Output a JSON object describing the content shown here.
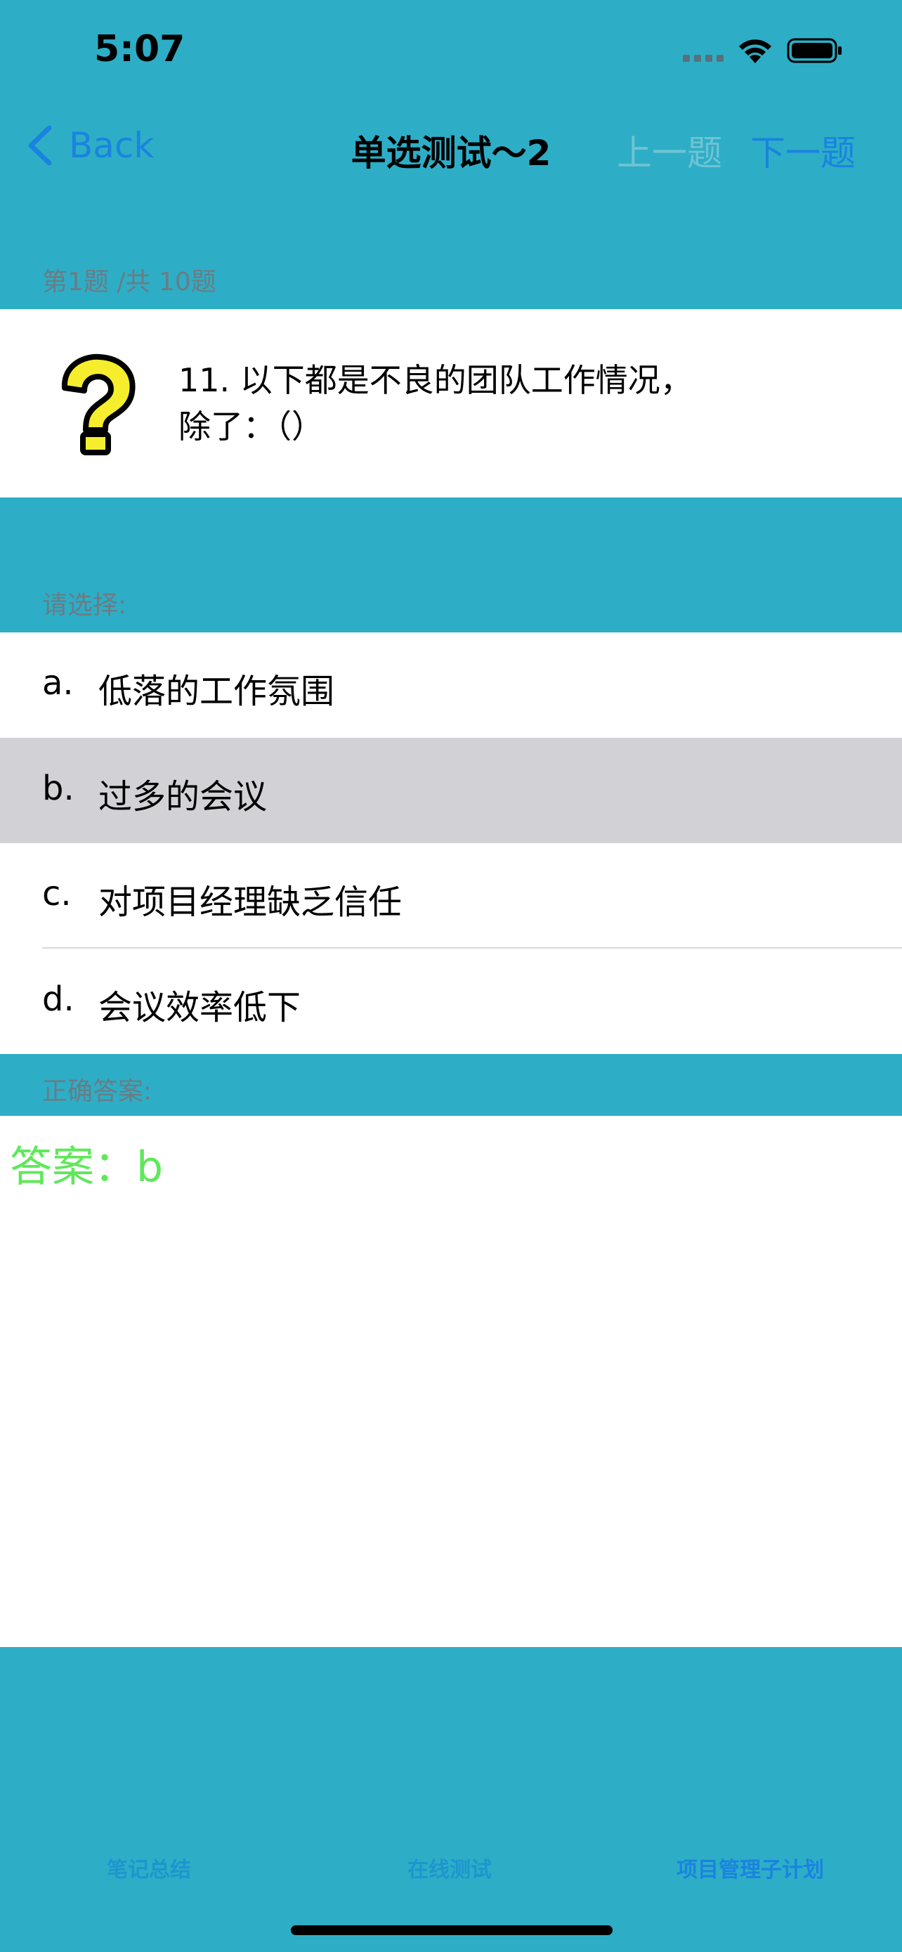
{
  "status_bar": {
    "time": "5:07"
  },
  "nav": {
    "back_label": "Back",
    "title": "单选测试～2",
    "prev_label": "上一题",
    "next_label": "下一题"
  },
  "progress_label": "第1题 /共 10题",
  "question": {
    "text_line1": "11.  以下都是不良的团队工作情况，",
    "text_line2": "除了：（）"
  },
  "choose_label": "请选择:",
  "options": [
    {
      "letter": "a.",
      "text": "低落的工作氛围"
    },
    {
      "letter": "b.",
      "text": "过多的会议"
    },
    {
      "letter": "c.",
      "text": "对项目经理缺乏信任"
    },
    {
      "letter": "d.",
      "text": "会议效率低下"
    }
  ],
  "selected_option": "b",
  "correct_answer_header": "正确答案:",
  "answer_text": "答案：b",
  "tabs": [
    {
      "label": "笔记总结",
      "active": false
    },
    {
      "label": "在线测试",
      "active": false
    },
    {
      "label": "项目管理子计划",
      "active": true
    }
  ],
  "colors": {
    "background": "#2daec6",
    "accent": "#1a83e0",
    "disabled": "#6fc3d4",
    "answer": "#5fe85a",
    "selected_row": "#d2d1d6"
  },
  "icons": [
    "back-chevron-icon",
    "wifi-icon",
    "battery-icon",
    "question-mark-icon"
  ]
}
